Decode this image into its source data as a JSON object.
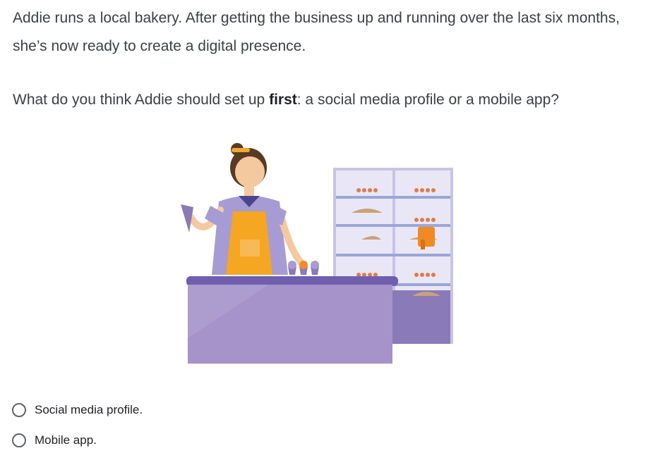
{
  "intro": {
    "text": "Addie runs a local bakery. After getting the business up and running over the last six months, she’s now ready to create a digital presence."
  },
  "question": {
    "before": "What do you think Addie should set up ",
    "bold": "first",
    "after": ": a social media profile or a mobile app?"
  },
  "colors": {
    "counter": "#a593c9",
    "counter_top": "#6f5fae",
    "display_case": "#8a7ab8",
    "apron": "#f5a623",
    "shirt": "#a79bd4"
  },
  "options": [
    {
      "label": "Social media profile.",
      "selected": false
    },
    {
      "label": "Mobile app.",
      "selected": false
    }
  ]
}
